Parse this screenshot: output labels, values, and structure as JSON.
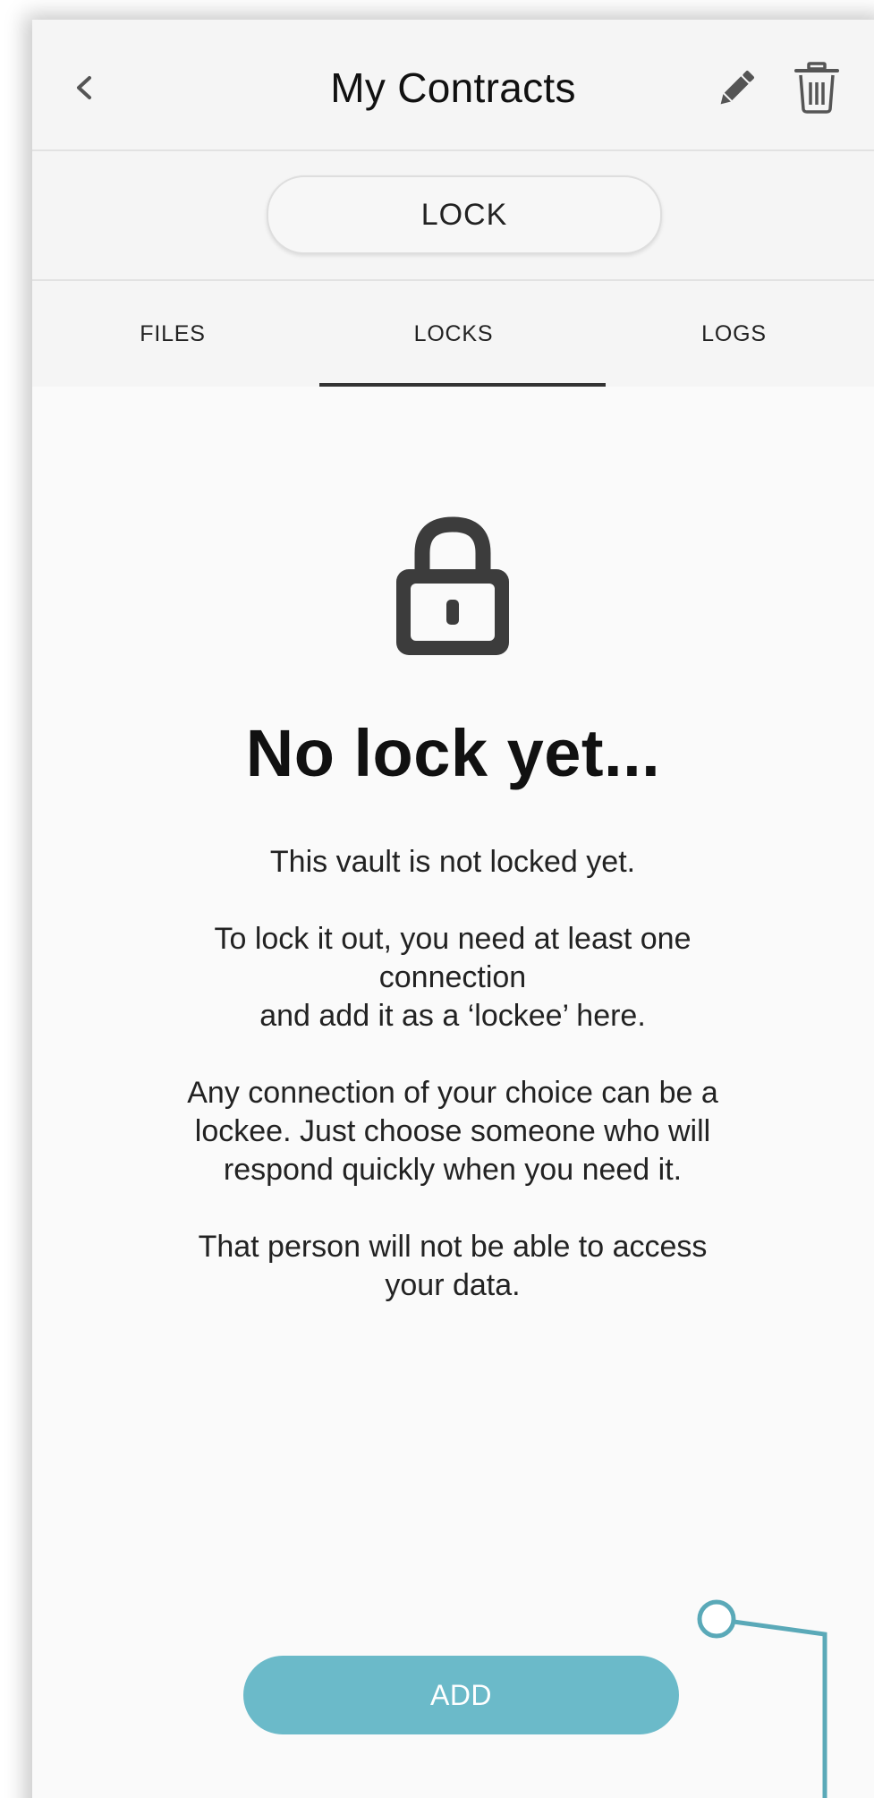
{
  "header": {
    "title": "My Contracts",
    "back_icon": "chevron-left-icon",
    "edit_icon": "pencil-icon",
    "delete_icon": "trash-icon"
  },
  "lock_button": {
    "label": "LOCK"
  },
  "tabs": [
    {
      "label": "FILES",
      "selected": false
    },
    {
      "label": "LOCKS",
      "selected": true
    },
    {
      "label": "LOGS",
      "selected": false
    }
  ],
  "empty_state": {
    "icon": "padlock-icon",
    "title": "No lock yet...",
    "paragraphs": [
      "This vault is not locked yet.",
      "To lock it out, you need at least one\nconnection\nand add it as a ‘lockee’ here.",
      "Any connection of your choice can be a\nlockee. Just choose someone who will\nrespond quickly when you need it.",
      "That person will not be able to access\nyour data."
    ]
  },
  "add_button": {
    "label": "ADD",
    "color": "#6bbac9"
  },
  "colors": {
    "header_bg": "#f5f5f5",
    "content_bg": "#fafafa",
    "accent": "#6bbac9",
    "callout": "#5aa9b8"
  }
}
